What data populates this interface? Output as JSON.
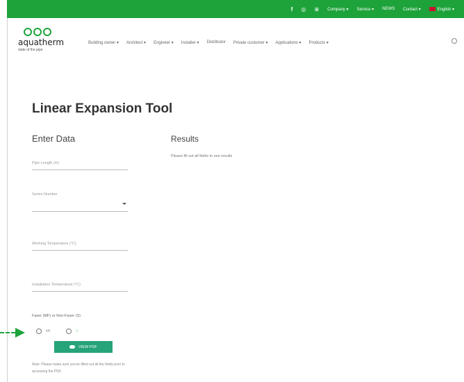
{
  "topbar": {
    "social": [
      "f",
      "◎",
      "≋"
    ],
    "company": "Company ▾",
    "service": "Service ▾",
    "news": "NEWS",
    "contact": "Contact ▾",
    "language": "English ▾"
  },
  "logo": {
    "name": "aquatherm",
    "tagline": "state of the pipe"
  },
  "nav": [
    "Building owner ▾",
    "Architect ▾",
    "Engineer ▾",
    "Installer ▾",
    "Distributor",
    "Private customer ▾",
    "Applications ▾",
    "Products ▾"
  ],
  "main": {
    "title": "Linear Expansion Tool",
    "enter_heading": "Enter Data",
    "results_heading": "Results",
    "results_message": "Please fill out all fields to see results",
    "fields": {
      "pipe_length_placeholder": "Pipe Length (m)",
      "series_placeholder": "Series Number",
      "working_temp_placeholder": "Working Temperature (°C)",
      "install_temp_placeholder": "Installation Temperature (°C)"
    },
    "fusion_label": "Faser (MF) or Non-Faser (S)",
    "radio_options": [
      "MF",
      "S"
    ],
    "view_button": "VIEW PDF",
    "note": "Note: Please make sure you've filled out all the fields prior to accessing the PDF."
  }
}
